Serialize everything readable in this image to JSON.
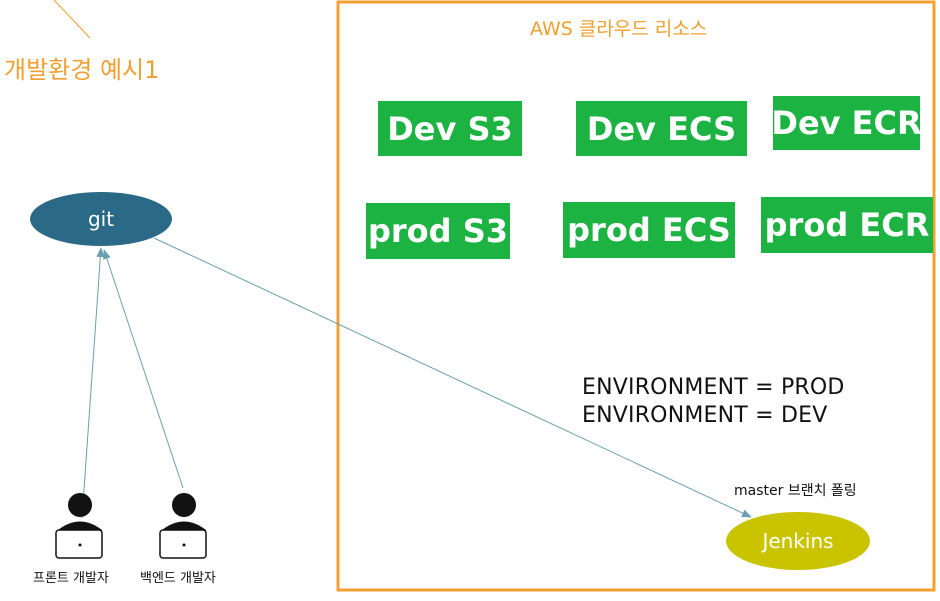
{
  "title": "개발환경 예시1",
  "aws": {
    "title": "AWS 클라우드 리소스",
    "resources": {
      "dev_s3": "Dev S3",
      "dev_ecs": "Dev ECS",
      "dev_ecr": "Dev ECR",
      "prod_s3": "prod S3",
      "prod_ecs": "prod ECS",
      "prod_ecr": "prod ECR"
    }
  },
  "git": {
    "label": "git"
  },
  "jenkins": {
    "label": "Jenkins",
    "polling": "master 브랜치 폴링"
  },
  "env": {
    "prod": "ENVIRONMENT = PROD",
    "dev": "ENVIRONMENT = DEV"
  },
  "developers": {
    "front": "프론트 개발자",
    "back": "백엔드 개발자"
  },
  "colors": {
    "accent_orange": "#f0a030",
    "resource_green": "#1db343",
    "git_blue": "#2a6a86",
    "jenkins_yellow": "#c9c300",
    "arrow": "#6a9fb0"
  }
}
